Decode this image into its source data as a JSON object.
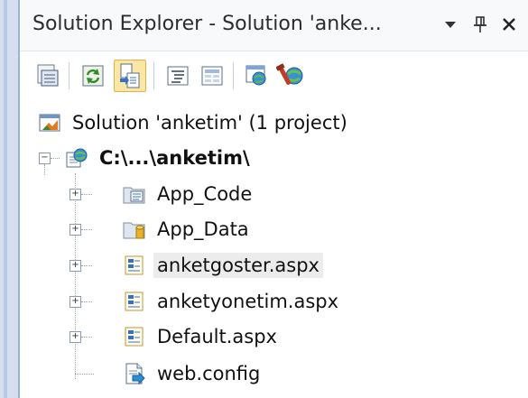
{
  "window": {
    "title": "Solution Explorer - Solution 'anke...",
    "dropdown_glyph": "▾",
    "pin_glyph": "ᵖ",
    "close_glyph": "✕"
  },
  "toolbar": {
    "buttons": [
      {
        "icon": "properties-icon"
      },
      {
        "icon": "refresh-icon"
      },
      {
        "icon": "show-all-files-icon",
        "selected": true
      },
      {
        "icon": "view-code-icon"
      },
      {
        "icon": "view-designer-icon"
      },
      {
        "icon": "copy-website-icon"
      },
      {
        "icon": "asp-net-configuration-icon"
      }
    ]
  },
  "tree": {
    "solution": {
      "label": "Solution 'anketim' (1 project)",
      "icon": "solution-icon"
    },
    "project": {
      "label": "C:\\...\\anketim\\",
      "icon": "website-project-icon",
      "expanded": true
    },
    "items": [
      {
        "label": "App_Code",
        "icon": "code-folder-icon",
        "expandable": true
      },
      {
        "label": "App_Data",
        "icon": "data-folder-icon",
        "expandable": true
      },
      {
        "label": "anketgoster.aspx",
        "icon": "aspx-page-icon",
        "expandable": true,
        "highlighted": true
      },
      {
        "label": "anketyonetim.aspx",
        "icon": "aspx-page-icon",
        "expandable": true
      },
      {
        "label": "Default.aspx",
        "icon": "aspx-page-icon",
        "expandable": true
      },
      {
        "label": "web.config",
        "icon": "config-file-icon",
        "expandable": false
      }
    ]
  }
}
